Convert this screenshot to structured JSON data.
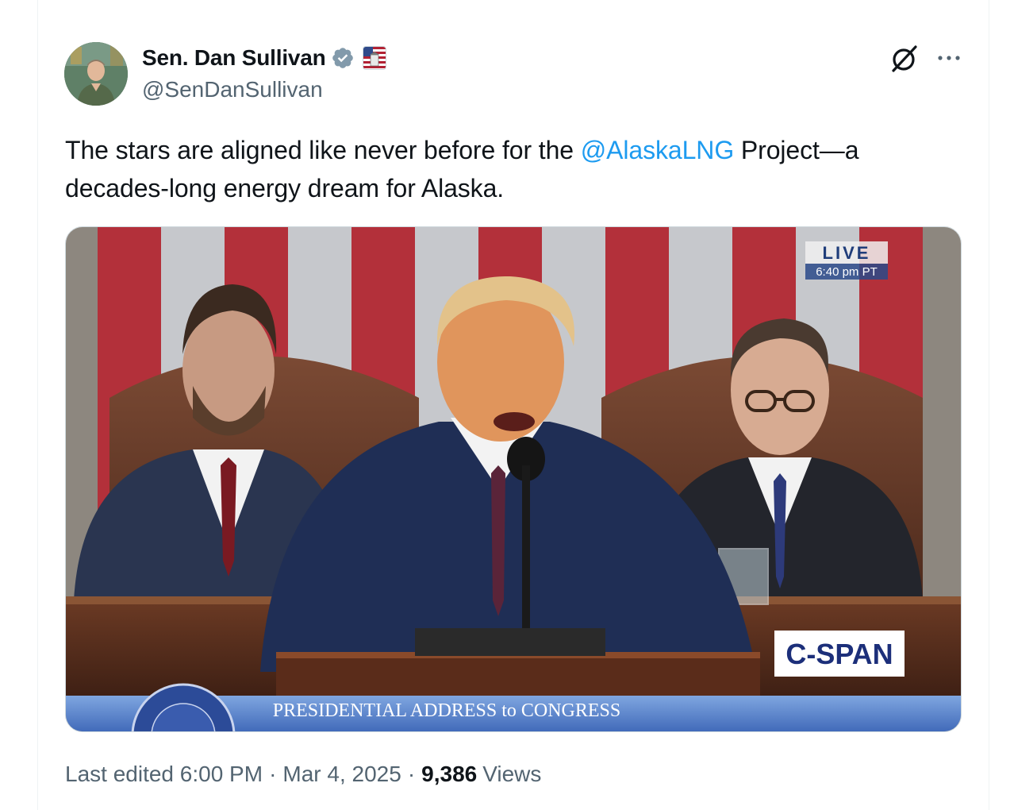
{
  "author": {
    "name": "Sen. Dan Sullivan",
    "handle": "@SenDanSullivan",
    "verified_icon": "verified-badge-icon",
    "affiliation_icon": "us-senate-badge-icon"
  },
  "header_actions": {
    "grok_icon": "grok-icon",
    "more_icon": "more-options-icon"
  },
  "tweet": {
    "text_before": "The stars are aligned like never before for the ",
    "mention": "@AlaskaLNG",
    "text_after": " Project—a decades-long energy dream for Alaska."
  },
  "media": {
    "live_label": "LIVE",
    "live_time": "6:40 pm PT",
    "network_logo": "C-SPAN",
    "banner": "PRESIDENTIAL ADDRESS to CONGRESS"
  },
  "meta": {
    "edited_label": "Last edited",
    "time": "6:00 PM",
    "separator": "·",
    "date": "Mar 4, 2025",
    "views_count": "9,386",
    "views_label": "Views"
  },
  "colors": {
    "link": "#1d9bf0",
    "secondary_text": "#536471",
    "primary_text": "#0f1419"
  }
}
